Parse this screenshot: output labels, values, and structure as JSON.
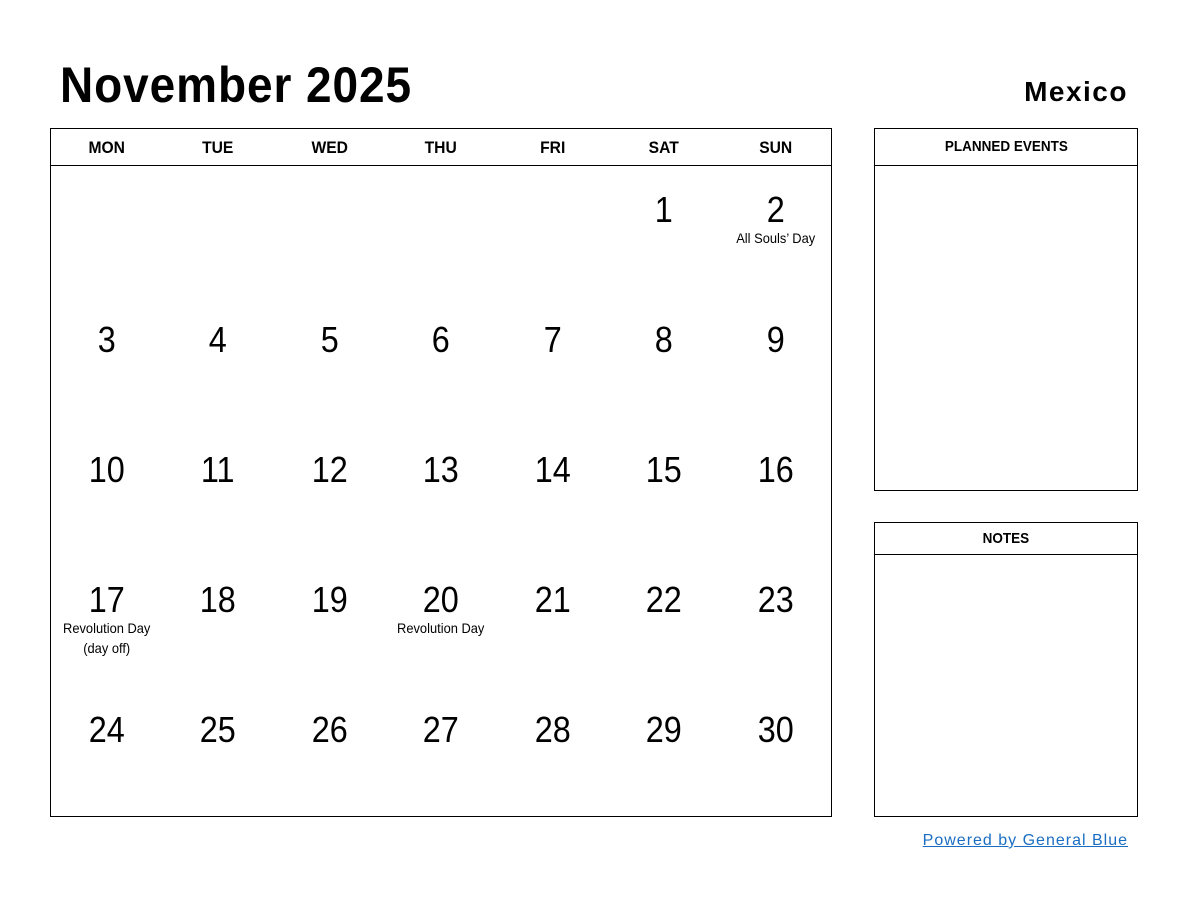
{
  "header": {
    "title": "November 2025",
    "country": "Mexico"
  },
  "calendar": {
    "weekdays": [
      "MON",
      "TUE",
      "WED",
      "THU",
      "FRI",
      "SAT",
      "SUN"
    ],
    "weeks": [
      [
        {
          "day": ""
        },
        {
          "day": ""
        },
        {
          "day": ""
        },
        {
          "day": ""
        },
        {
          "day": ""
        },
        {
          "day": "1"
        },
        {
          "day": "2",
          "event": "All Souls’ Day"
        }
      ],
      [
        {
          "day": "3"
        },
        {
          "day": "4"
        },
        {
          "day": "5"
        },
        {
          "day": "6"
        },
        {
          "day": "7"
        },
        {
          "day": "8"
        },
        {
          "day": "9"
        }
      ],
      [
        {
          "day": "10"
        },
        {
          "day": "11"
        },
        {
          "day": "12"
        },
        {
          "day": "13"
        },
        {
          "day": "14"
        },
        {
          "day": "15"
        },
        {
          "day": "16"
        }
      ],
      [
        {
          "day": "17",
          "event": "Revolution Day",
          "event2": "(day off)"
        },
        {
          "day": "18"
        },
        {
          "day": "19"
        },
        {
          "day": "20",
          "event": "Revolution Day"
        },
        {
          "day": "21"
        },
        {
          "day": "22"
        },
        {
          "day": "23"
        }
      ],
      [
        {
          "day": "24"
        },
        {
          "day": "25"
        },
        {
          "day": "26"
        },
        {
          "day": "27"
        },
        {
          "day": "28"
        },
        {
          "day": "29"
        },
        {
          "day": "30"
        }
      ]
    ]
  },
  "panels": {
    "planned_events_label": "PLANNED EVENTS",
    "notes_label": "NOTES"
  },
  "footer": {
    "link_text": "Powered by General Blue",
    "link_color": "#1a6dc2"
  }
}
